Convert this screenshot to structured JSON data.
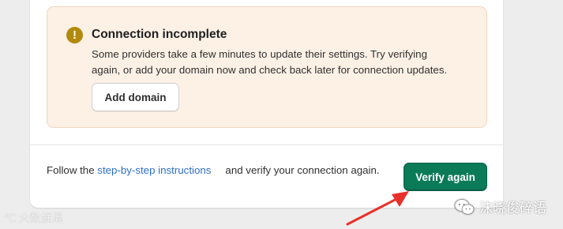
{
  "banner": {
    "icon": "warning-icon",
    "title": "Connection incomplete",
    "line1": "Some providers take a few minutes to update their settings. Try verifying",
    "line2": "again, or add your domain now and check back later for connection updates.",
    "add_domain_label": "Add domain"
  },
  "footer": {
    "prefix": "Follow the ",
    "link_label": "step-by-step instructions",
    "suffix": "and verify your connection again.",
    "verify_label": "Verify again"
  },
  "watermarks": {
    "left": "大数据混",
    "right": "沫晓俊碎语"
  },
  "colors": {
    "accent": "#0b7a57",
    "warning": "#b28a0b",
    "banner_bg": "#fdf1e6",
    "link": "#2c6ecb",
    "annotation_arrow": "#e8302a"
  }
}
